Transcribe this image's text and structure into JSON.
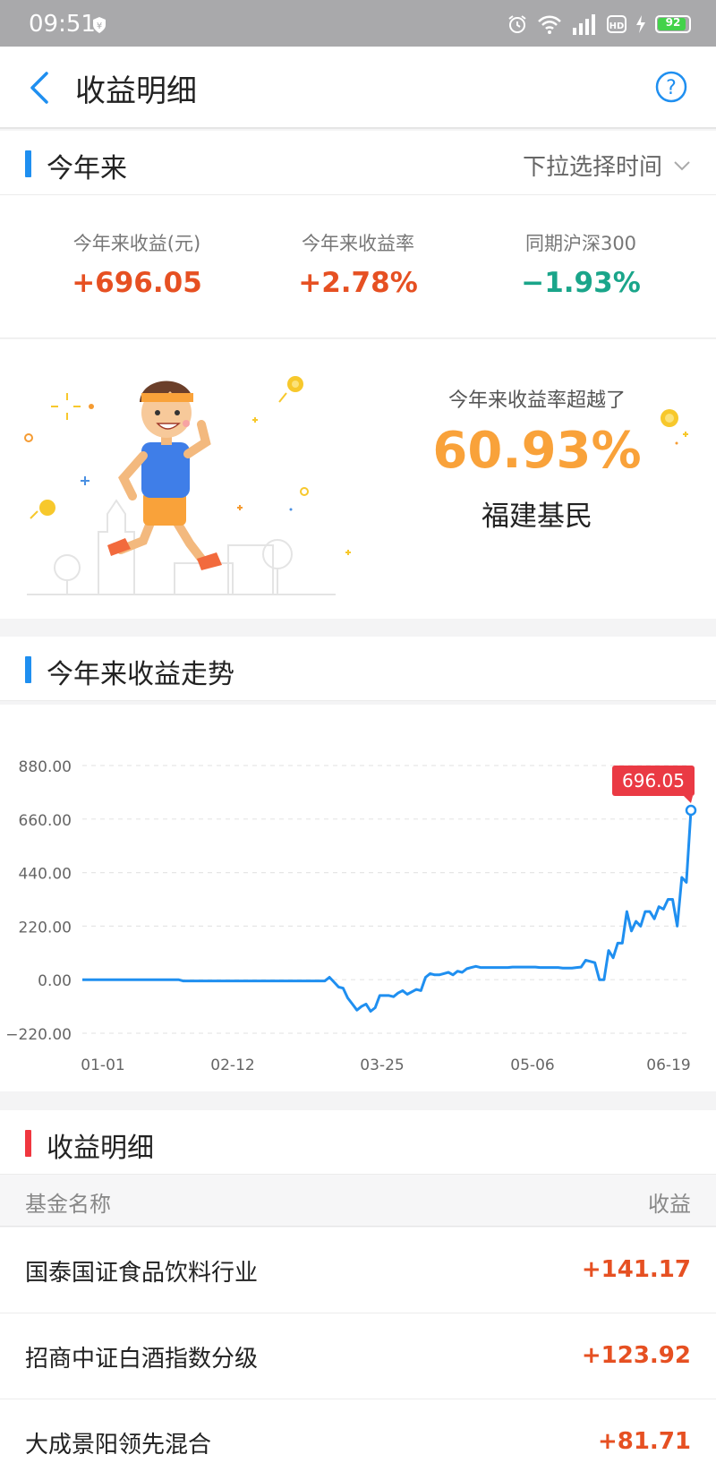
{
  "status_bar": {
    "time": "09:51",
    "battery": "92",
    "network": "4G",
    "hd": "HD"
  },
  "nav": {
    "title": "收益明细",
    "back_icon": "chevron-left-icon",
    "help_icon": "help-circle-icon"
  },
  "ytd": {
    "section_title": "今年来",
    "time_picker": "下拉选择时间",
    "metrics": [
      {
        "label": "今年来收益(元)",
        "value": "+696.05"
      },
      {
        "label": "今年来收益率",
        "value": "+2.78%"
      },
      {
        "label": "同期沪深300",
        "value": "−1.93%"
      }
    ]
  },
  "ranking": {
    "label": "今年来收益率超越了",
    "percent": "60.93%",
    "group": "福建基民"
  },
  "trend": {
    "section_title": "今年来收益走势",
    "callout": "696.05"
  },
  "chart_data": {
    "type": "line",
    "y_ticks": [
      "880.00",
      "660.00",
      "440.00",
      "220.00",
      "0.00",
      "−220.00"
    ],
    "x_ticks": [
      "01-01",
      "02-12",
      "03-25",
      "05-06",
      "06-19"
    ],
    "ylim": [
      -220,
      880
    ],
    "grid": true,
    "series": [
      {
        "color": "#1f8ff0",
        "values": [
          0,
          0,
          0,
          0,
          0,
          0,
          0,
          0,
          0,
          0,
          0,
          0,
          0,
          0,
          0,
          0,
          0,
          0,
          0,
          0,
          0,
          0,
          -5,
          -5,
          -5,
          -5,
          -5,
          -5,
          -5,
          -5,
          -5,
          -5,
          -5,
          -5,
          -5,
          -5,
          -5,
          -5,
          -5,
          -5,
          -5,
          -5,
          -5,
          -5,
          -5,
          -5,
          -5,
          -5,
          -5,
          -5,
          -5,
          -5,
          -5,
          -5,
          10,
          -10,
          -30,
          -35,
          -75,
          -100,
          -125,
          -110,
          -100,
          -130,
          -115,
          -65,
          -65,
          -65,
          -70,
          -55,
          -45,
          -60,
          -50,
          -40,
          -45,
          10,
          25,
          20,
          20,
          25,
          30,
          20,
          35,
          30,
          45,
          50,
          55,
          50,
          50,
          50,
          50,
          50,
          50,
          50,
          52,
          52,
          52,
          52,
          52,
          52,
          50,
          50,
          50,
          50,
          50,
          48,
          48,
          48,
          50,
          52,
          80,
          75,
          70,
          0,
          0,
          120,
          90,
          150,
          150,
          280,
          200,
          240,
          220,
          280,
          280,
          250,
          300,
          290,
          330,
          330,
          220,
          420,
          400,
          696.05
        ]
      }
    ],
    "last_label": "696.05"
  },
  "detail": {
    "section_title": "收益明细",
    "col_name": "基金名称",
    "col_gain": "收益",
    "rows": [
      {
        "name": "国泰国证食品饮料行业",
        "gain": "+141.17"
      },
      {
        "name": "招商中证白酒指数分级",
        "gain": "+123.92"
      },
      {
        "name": "大成景阳领先混合",
        "gain": "+81.71"
      }
    ]
  }
}
